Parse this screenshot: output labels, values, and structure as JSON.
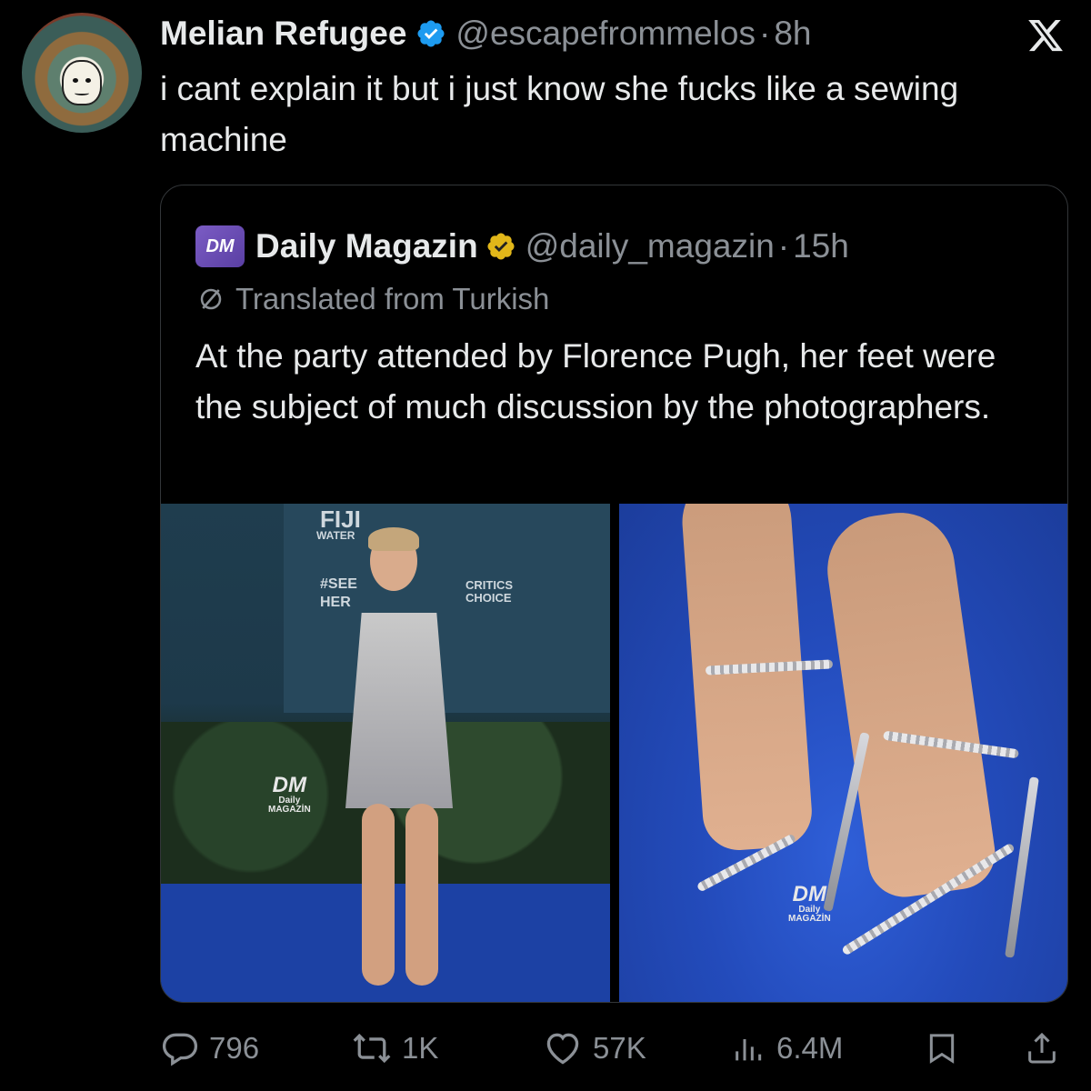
{
  "tweet": {
    "author_name": "Melian Refugee",
    "author_handle": "@escapefrommelos",
    "separator": "·",
    "time": "8h",
    "text": "i cant explain it but i just know she fucks like a sewing machine"
  },
  "quoted": {
    "logo_text": "DM",
    "author_name": "Daily Magazin",
    "author_handle": "@daily_magazin",
    "separator": "·",
    "time": "15h",
    "translation_note": "Translated from Turkish",
    "text": "At the party attended by Florence Pugh, her feet were the subject of much discussion by the photographers.",
    "photo_left": {
      "backdrop": [
        "FIJI",
        "WATER",
        "#SEE",
        "HER",
        "CRITICS",
        "CHOICE"
      ],
      "watermark_big": "DM",
      "watermark_small1": "Daily",
      "watermark_small2": "MAGAZİN"
    },
    "photo_right": {
      "watermark_big": "DM",
      "watermark_small1": "Daily",
      "watermark_small2": "MAGAZİN"
    }
  },
  "actions": {
    "replies": "796",
    "reposts": "1K",
    "likes": "57K",
    "views": "6.4M"
  },
  "colors": {
    "background": "#000000",
    "text": "#e7e9ea",
    "muted": "#8b9096",
    "verified_blue": "#1d9bf0",
    "verified_gold": "#e2b719",
    "border": "#333639"
  },
  "icons": [
    "verified-badge-icon",
    "x-logo-icon",
    "gold-verified-badge-icon",
    "translate-icon",
    "reply-icon",
    "repost-icon",
    "like-icon",
    "views-icon",
    "bookmark-icon",
    "share-icon"
  ]
}
